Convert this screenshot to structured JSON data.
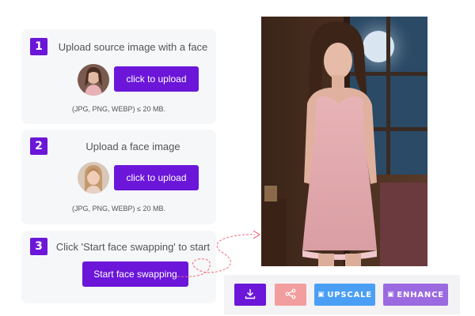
{
  "steps": [
    {
      "number": "1",
      "title": "Upload source image with a face",
      "button_label": "click to upload",
      "formats": "(JPG, PNG, WEBP) ≤ 20 MB."
    },
    {
      "number": "2",
      "title": "Upload a face image",
      "button_label": "click to upload",
      "formats": "(JPG, PNG, WEBP) ≤ 20 MB."
    },
    {
      "number": "3",
      "title": "Click 'Start face swapping' to start",
      "button_label": "Start face swapping"
    }
  ],
  "toolbar": {
    "download_icon": "download-icon",
    "share_icon": "share-icon",
    "upscale_label": "UPSCALE",
    "enhance_label": "ENHANCE"
  },
  "colors": {
    "accent": "#6b16d8",
    "share": "#f29e9e",
    "upscale": "#4a9ff5",
    "enhance": "#9b6ae0",
    "arrow": "#ef6b7a"
  }
}
